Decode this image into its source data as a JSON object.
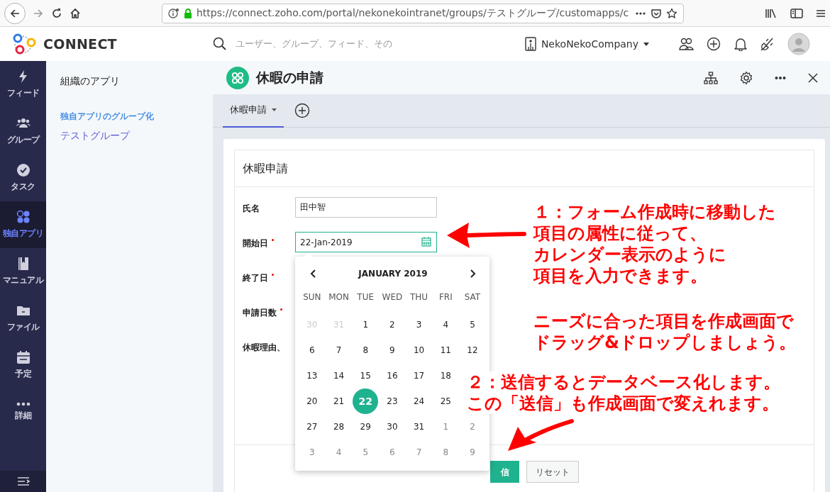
{
  "browser": {
    "url": "https://connect.zoho.com/portal/nekonekointranet/groups/テストグループ/customapps/c"
  },
  "app": {
    "brand": "CONNECT",
    "search": {
      "placeholder": "ユーザー、グループ、フィード、その"
    },
    "company": "NekoNekoCompany"
  },
  "nav": [
    {
      "label": "フィード",
      "selected": false
    },
    {
      "label": "グループ",
      "selected": false
    },
    {
      "label": "タスク",
      "selected": false
    },
    {
      "label": "独自アプリ",
      "selected": true
    },
    {
      "label": "マニュアル",
      "selected": false
    },
    {
      "label": "ファイル",
      "selected": false
    },
    {
      "label": "予定",
      "selected": false
    },
    {
      "label": "詳細",
      "selected": false
    }
  ],
  "sidebar": {
    "title": "組織のアプリ",
    "section": "独自アプリのグループ化",
    "items": [
      {
        "label": "テストグループ"
      }
    ]
  },
  "app_header": {
    "title": "休暇の申請"
  },
  "tabs": [
    {
      "label": "休暇申請",
      "selected": true
    }
  ],
  "form": {
    "title": "休暇申請",
    "fields": [
      {
        "label": "氏名",
        "required": false,
        "kind": "text",
        "value": "田中智",
        "focused": false
      },
      {
        "label": "開始日",
        "required": true,
        "kind": "date",
        "value": "22-Jan-2019",
        "focused": true
      },
      {
        "label": "終了日",
        "required": true
      },
      {
        "label": "申請日数",
        "required": true
      },
      {
        "label": "休暇理由、",
        "required": false
      }
    ],
    "buttons": [
      {
        "label": "信",
        "kind": "primary"
      },
      {
        "label": "リセット",
        "kind": "secondary"
      }
    ]
  },
  "calendar": {
    "month": "JANUARY 2019",
    "weekdays": [
      "SUN",
      "MON",
      "TUE",
      "WED",
      "THU",
      "FRI",
      "SAT"
    ],
    "weeks": [
      [
        {
          "day": "30",
          "kind": "prev"
        },
        {
          "day": "31",
          "kind": "prev"
        },
        {
          "day": "1",
          "kind": "cur"
        },
        {
          "day": "2",
          "kind": "cur"
        },
        {
          "day": "3",
          "kind": "cur"
        },
        {
          "day": "4",
          "kind": "cur"
        },
        {
          "day": "5",
          "kind": "cur"
        }
      ],
      [
        {
          "day": "6",
          "kind": "cur"
        },
        {
          "day": "7",
          "kind": "cur"
        },
        {
          "day": "8",
          "kind": "cur"
        },
        {
          "day": "9",
          "kind": "cur"
        },
        {
          "day": "10",
          "kind": "cur"
        },
        {
          "day": "11",
          "kind": "cur"
        },
        {
          "day": "12",
          "kind": "cur"
        }
      ],
      [
        {
          "day": "13",
          "kind": "cur"
        },
        {
          "day": "14",
          "kind": "cur"
        },
        {
          "day": "15",
          "kind": "cur"
        },
        {
          "day": "16",
          "kind": "cur"
        },
        {
          "day": "17",
          "kind": "cur"
        },
        {
          "day": "18",
          "kind": "cur"
        },
        {
          "kind": "covered"
        }
      ],
      [
        {
          "day": "20",
          "kind": "cur"
        },
        {
          "day": "21",
          "kind": "cur"
        },
        {
          "day": "22",
          "kind": "cur",
          "selected": true
        },
        {
          "day": "23",
          "kind": "cur"
        },
        {
          "day": "24",
          "kind": "cur"
        },
        {
          "day": "25",
          "kind": "cur"
        },
        {
          "kind": "covered"
        }
      ],
      [
        {
          "day": "27",
          "kind": "cur"
        },
        {
          "day": "28",
          "kind": "cur"
        },
        {
          "day": "29",
          "kind": "cur"
        },
        {
          "day": "30",
          "kind": "cur"
        },
        {
          "day": "31",
          "kind": "cur"
        },
        {
          "day": "1",
          "kind": "next"
        },
        {
          "day": "2",
          "kind": "next"
        }
      ],
      [
        {
          "day": "3",
          "kind": "next"
        },
        {
          "day": "4",
          "kind": "next"
        },
        {
          "day": "5",
          "kind": "next"
        },
        {
          "day": "6",
          "kind": "next"
        },
        {
          "day": "7",
          "kind": "next"
        },
        {
          "day": "8",
          "kind": "next"
        },
        {
          "day": "9",
          "kind": "next"
        }
      ]
    ]
  },
  "annotations": [
    {
      "lines": [
        "１：フォーム作成時に移動した",
        "項目の属性に従って、",
        "カレンダー表示のように",
        "項目を入力できます。"
      ]
    },
    {
      "lines": [
        "ニーズに合った項目を作成画面で",
        "ドラッグ&ドロップしましょう。"
      ]
    },
    {
      "lines": [
        "２：送信するとデータベース化します。",
        "この「送信」も作成画面で変えれます。"
      ]
    }
  ]
}
